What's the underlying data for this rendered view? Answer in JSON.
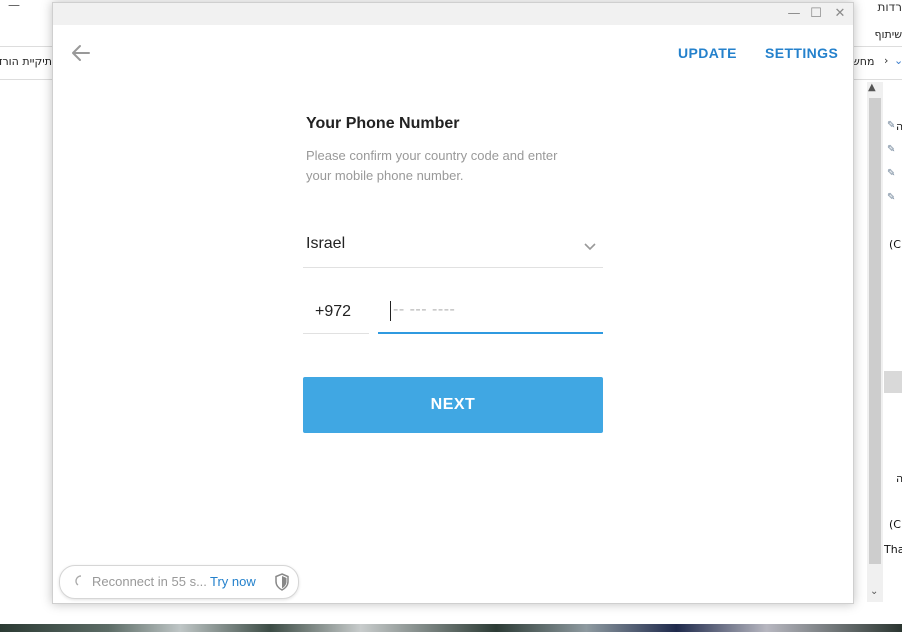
{
  "background_window": {
    "tab_label": "רדות",
    "share_label": "שיתוף",
    "address_left": "תיקיית הורד",
    "address_right": "מחש",
    "side_texts": [
      "ה",
      "(C",
      "ה",
      "(C",
      "Tha"
    ]
  },
  "window": {
    "minimize": "—",
    "maximize": "☐",
    "close": "✕"
  },
  "header": {
    "back_icon": "arrow-left-icon",
    "update_label": "UPDATE",
    "settings_label": "SETTINGS"
  },
  "login": {
    "title": "Your Phone Number",
    "description": "Please confirm your country code and enter your mobile phone number.",
    "country": "Israel",
    "country_code": "+972",
    "phone_placeholder": "-- --- ----",
    "next_label": "NEXT"
  },
  "connection": {
    "status": "Reconnect in 55 s...",
    "try_now_label": "Try now",
    "shield_icon": "shield-icon"
  },
  "colors": {
    "accent": "#40a7e3",
    "link": "#2481cc",
    "input_active": "#2f9ae0"
  }
}
